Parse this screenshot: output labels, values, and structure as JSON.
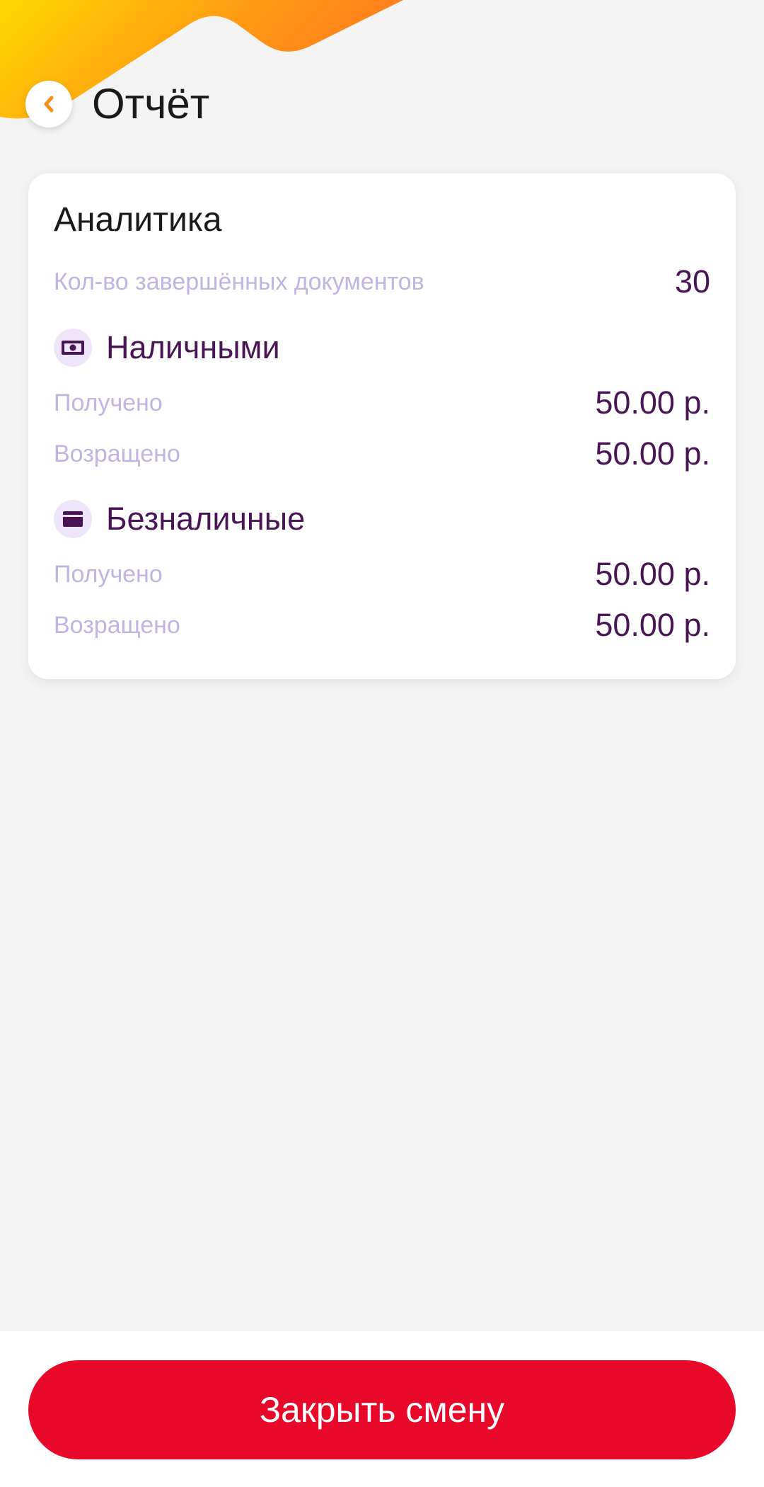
{
  "header": {
    "title": "Отчёт",
    "back_icon": "chevron-left-icon"
  },
  "colors": {
    "accent_orange": "#f5901e",
    "gradient_yellow": "#ffd900",
    "purple_text": "#4a1556",
    "label_lilac": "#c1b4e0",
    "button_red": "#e8092a"
  },
  "analytics": {
    "title": "Аналитика",
    "completed_docs_label": "Кол-во завершённых документов",
    "completed_docs_value": "30",
    "cash": {
      "title": "Наличными",
      "icon": "cash-icon",
      "received_label": "Получено",
      "received_value": "50.00 р.",
      "returned_label": "Возращено",
      "returned_value": "50.00 р."
    },
    "cashless": {
      "title": "Безналичные",
      "icon": "card-icon",
      "received_label": "Получено",
      "received_value": "50.00 р.",
      "returned_label": "Возращено",
      "returned_value": "50.00 р."
    }
  },
  "footer": {
    "close_shift_label": "Закрыть смену"
  }
}
